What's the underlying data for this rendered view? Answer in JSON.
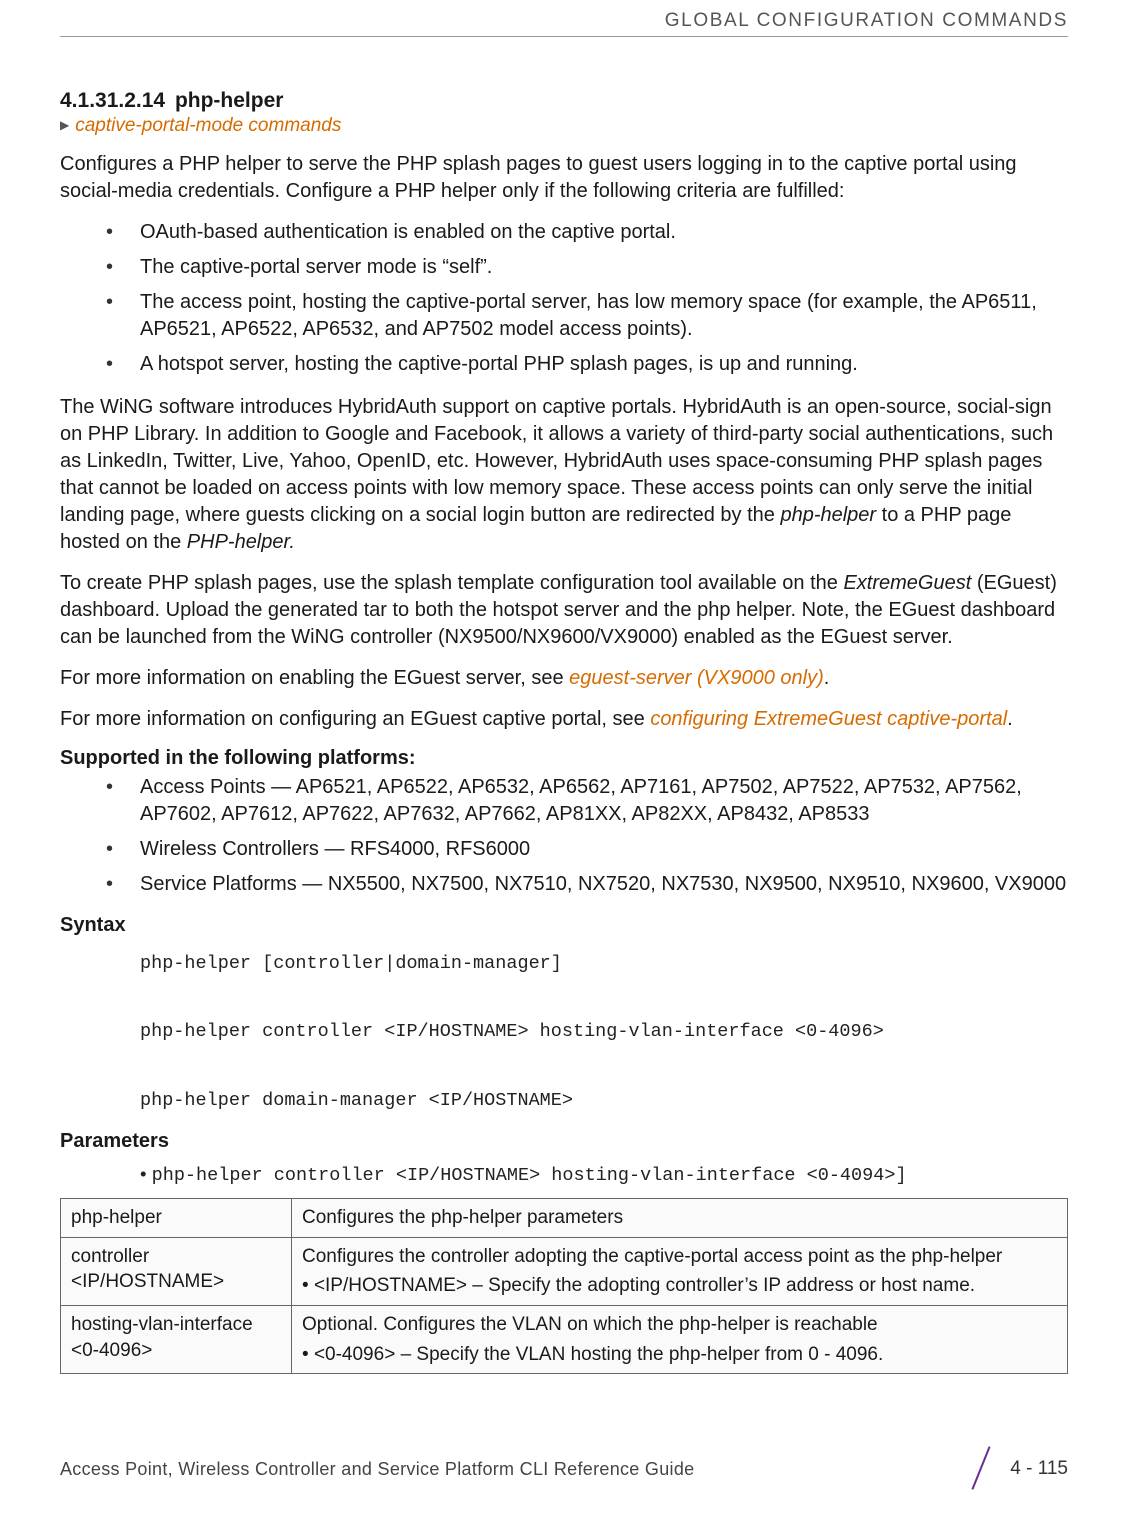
{
  "running_head": "GLOBAL CONFIGURATION COMMANDS",
  "section": {
    "number": "4.1.31.2.14",
    "title": "php-helper",
    "breadcrumb": "captive-portal-mode commands"
  },
  "intro_para": "Configures a PHP helper to serve the PHP splash pages to guest users logging in to the captive portal using social-media credentials. Configure a PHP helper only if the following criteria are fulfilled:",
  "criteria": [
    "OAuth-based authentication is enabled on the captive portal.",
    "The captive-portal server mode is “self”.",
    "The access point, hosting the captive-portal server, has low memory space (for example, the AP6511, AP6521, AP6522, AP6532, and AP7502 model access points).",
    "A hotspot server, hosting the captive-portal PHP splash pages, is up and running."
  ],
  "wing_para_parts": {
    "pre": "The WiNG software introduces HybridAuth support on captive portals. HybridAuth is an open-source, social-sign on PHP Library. In addition to Google and Facebook, it allows a variety of third-party social authentications, such as LinkedIn, Twitter, Live, Yahoo, OpenID, etc. However, HybridAuth uses space-consuming PHP splash pages that cannot be loaded on access points with low memory space. These access points can only serve the initial landing page, where guests clicking on a social login button are redirected by the ",
    "em1": "php-helper",
    "mid": " to a PHP page hosted on the ",
    "em2": "PHP-helper.",
    "post": ""
  },
  "splash_para_parts": {
    "pre": "To create PHP splash pages, use the splash template configuration tool available on the ",
    "em": "ExtremeGuest",
    "post": " (EGuest) dashboard. Upload the generated tar to both the hotspot server and the php helper. Note, the EGuest dashboard can be launched from the WiNG controller (NX9500/NX9600/VX9000) enabled as the EGuest server."
  },
  "more1": {
    "pre": "For more information on enabling the EGuest server, see ",
    "link": "eguest-server (VX9000 only)",
    "post": "."
  },
  "more2": {
    "pre": "For more information on configuring an EGuest captive portal, see ",
    "link": "configuring ExtremeGuest captive-portal",
    "post": "."
  },
  "supported_head": "Supported in the following platforms:",
  "supported": [
    "Access Points — AP6521, AP6522, AP6532, AP6562, AP7161, AP7502, AP7522, AP7532, AP7562, AP7602, AP7612, AP7622, AP7632, AP7662, AP81XX, AP82XX, AP8432, AP8533",
    "Wireless Controllers — RFS4000, RFS6000",
    "Service Platforms — NX5500, NX7500, NX7510, NX7520, NX7530, NX9500, NX9510, NX9600, VX9000"
  ],
  "syntax_head": "Syntax",
  "syntax_lines": "php-helper [controller|domain-manager]\n\nphp-helper controller <IP/HOSTNAME> hosting-vlan-interface <0-4096>\n\nphp-helper domain-manager <IP/HOSTNAME>",
  "params_head": "Parameters",
  "param_line": "php-helper controller <IP/HOSTNAME> hosting-vlan-interface <0-4094>]",
  "param_table": [
    {
      "name": "php-helper",
      "desc": "Configures the php-helper parameters",
      "sub": []
    },
    {
      "name": "controller <IP/HOSTNAME>",
      "desc": "Configures the controller adopting the captive-portal access point as the php-helper",
      "sub": [
        "<IP/HOSTNAME> – Specify the adopting controller’s IP address or host name."
      ]
    },
    {
      "name": "hosting-vlan-interface <0-4096>",
      "desc": "Optional. Configures the VLAN on which the php-helper is reachable",
      "sub": [
        "<0-4096> – Specify the VLAN hosting the php-helper from 0 - 4096."
      ]
    }
  ],
  "footer": {
    "title": "Access Point, Wireless Controller and Service Platform CLI Reference Guide",
    "pagenum": "4 - 115"
  }
}
